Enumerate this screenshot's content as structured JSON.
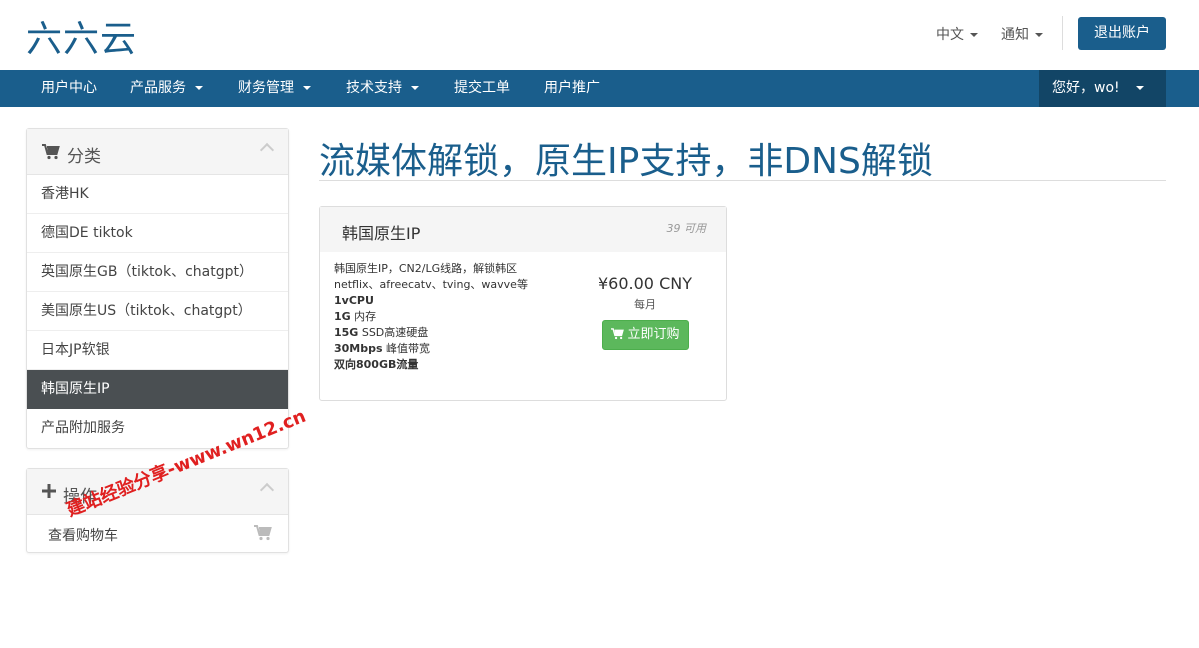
{
  "header": {
    "logo": "六六云",
    "language_label": "中文",
    "notifications_label": "通知",
    "logout_label": "退出账户",
    "brand_color": "#1a5e8c"
  },
  "nav": {
    "items": [
      {
        "label": "用户中心",
        "dropdown": false
      },
      {
        "label": "产品服务",
        "dropdown": true
      },
      {
        "label": "财务管理",
        "dropdown": true
      },
      {
        "label": "技术支持",
        "dropdown": true
      },
      {
        "label": "提交工单",
        "dropdown": false
      },
      {
        "label": "用户推广",
        "dropdown": false
      }
    ],
    "user_greeting": "您好，wo!"
  },
  "sidebar": {
    "categories": {
      "title": "分类",
      "icon": "cart-icon",
      "items": [
        {
          "label": "香港HK",
          "active": false
        },
        {
          "label": "德国DE tiktok",
          "active": false
        },
        {
          "label": "英国原生GB（tiktok、chatgpt）",
          "active": false
        },
        {
          "label": "美国原生US（tiktok、chatgpt）",
          "active": false
        },
        {
          "label": "日本JP软银",
          "active": false
        },
        {
          "label": "韩国原生IP",
          "active": true
        },
        {
          "label": "产品附加服务",
          "active": false
        }
      ]
    },
    "actions": {
      "title": "操作",
      "icon": "plus-icon",
      "items": [
        {
          "label": "查看购物车",
          "icon": "cart-icon"
        }
      ]
    }
  },
  "main": {
    "title": "流媒体解锁，原生IP支持，非DNS解锁",
    "products": [
      {
        "name": "韩国原生IP",
        "availability": "39 可用",
        "description_lines": [
          {
            "bold": "",
            "text": "韩国原生IP，CN2/LG线路，解锁韩区"
          },
          {
            "bold": "",
            "text": "netflix、afreecatv、tving、wavve等"
          },
          {
            "bold": "1vCPU",
            "text": ""
          },
          {
            "bold": "1G",
            "text": " 内存"
          },
          {
            "bold": "15G",
            "text": " SSD高速硬盘"
          },
          {
            "bold": "30Mbps",
            "text": " 峰值带宽"
          },
          {
            "bold": "双向800GB流量",
            "text": ""
          }
        ],
        "price": "¥60.00 CNY",
        "cycle": "每月",
        "order_label": "立即订购"
      }
    ]
  },
  "watermark": "建站经验分享-www.wn12.cn"
}
